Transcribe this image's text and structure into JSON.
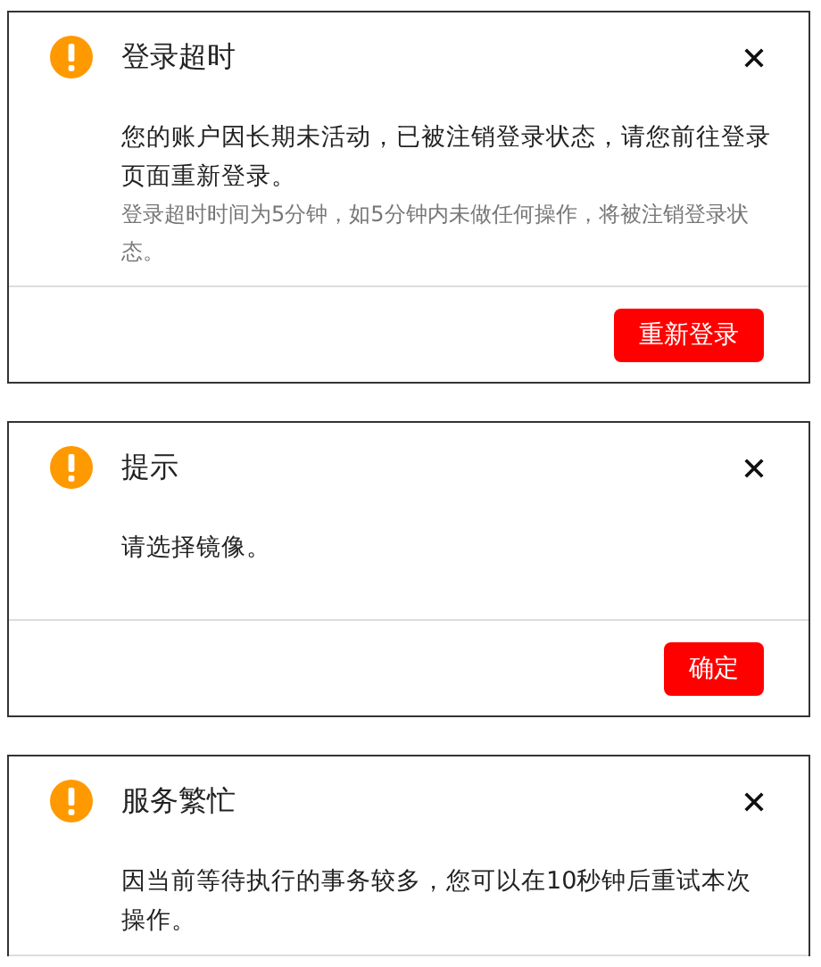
{
  "dialogs": [
    {
      "title": "登录超时",
      "message": "您的账户因长期未活动，已被注销登录状态，请您前往登录页面重新登录。",
      "note": "登录超时时间为5分钟，如5分钟内未做任何操作，将被注销登录状态。",
      "buttons": [
        "重新登录"
      ]
    },
    {
      "title": "提示",
      "message": "请选择镜像。",
      "buttons": [
        "确定"
      ]
    },
    {
      "title": "服务繁忙",
      "message": "因当前等待执行的事务较多，您可以在10秒钟后重试本次操作。"
    }
  ]
}
